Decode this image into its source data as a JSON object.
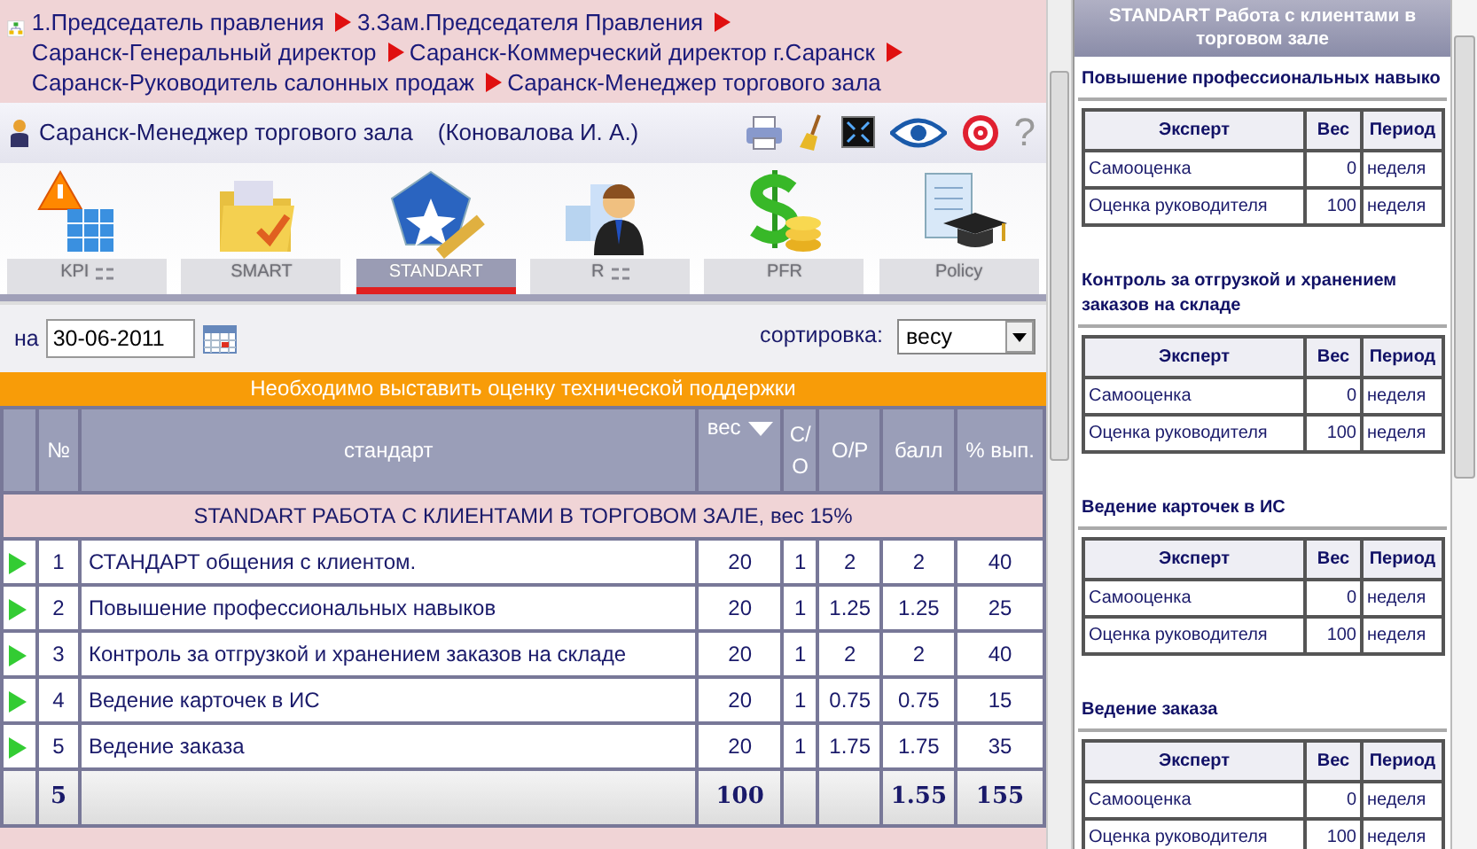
{
  "breadcrumb": [
    "1.Председатель правления",
    "3.Зам.Председателя Правления",
    "Саранск-Генеральный директор",
    "Саранск-Коммерческий директор г.Саранск",
    "Саранск-Руководитель салонных продаж",
    "Саранск-Менеджер торгового зала"
  ],
  "user": {
    "position": "Саранск-Менеджер торгового зала",
    "name": "(Коновалова И. А.)"
  },
  "help_glyph": "?",
  "tabs": [
    {
      "label": "KPI",
      "kind": "kpi",
      "has_menu": true,
      "selected": false
    },
    {
      "label": "SMART",
      "kind": "smart",
      "has_menu": false,
      "selected": false
    },
    {
      "label": "STANDART",
      "kind": "standart",
      "has_menu": false,
      "selected": true
    },
    {
      "label": "R",
      "kind": "rating",
      "has_menu": true,
      "selected": false
    },
    {
      "label": "PFR",
      "kind": "pfr",
      "has_menu": false,
      "selected": false
    },
    {
      "label": "Policy",
      "kind": "policy",
      "has_menu": false,
      "selected": false
    }
  ],
  "filter": {
    "date_label": "на",
    "date": "30-06-2011",
    "sort_label": "сортировка:",
    "sort_value": "весу"
  },
  "notice": "Необходимо выставить оценку технической поддержки",
  "table": {
    "columns": [
      {
        "label": "№",
        "sorted": false
      },
      {
        "label": "стандарт",
        "sorted": false
      },
      {
        "label": "вес",
        "sorted": true
      },
      {
        "label": "С/О",
        "sorted": false
      },
      {
        "label": "О/Р",
        "sorted": false
      },
      {
        "label": "балл",
        "sorted": false
      },
      {
        "label": "% вып.",
        "sorted": false
      }
    ],
    "group": "STANDART РАБОТА С КЛИЕНТАМИ В ТОРГОВОМ ЗАЛЕ, вес 15%",
    "rows": [
      [
        "1",
        "СТАНДАРТ общения с клиентом.",
        "20",
        "1",
        "2",
        "2",
        "40"
      ],
      [
        "2",
        "Повышение профессиональных навыков",
        "20",
        "1",
        "1.25",
        "1.25",
        "25"
      ],
      [
        "3",
        "Контроль за отгрузкой и хранением заказов на складе",
        "20",
        "1",
        "2",
        "2",
        "40"
      ],
      [
        "4",
        "Ведение карточек в ИС",
        "20",
        "1",
        "0.75",
        "0.75",
        "15"
      ],
      [
        "5",
        "Ведение заказа",
        "20",
        "1",
        "1.75",
        "1.75",
        "35"
      ]
    ],
    "totals": {
      "count": "5",
      "weight": "100",
      "score": "1.55",
      "percent": "155"
    }
  },
  "sidebar": {
    "title": "STANDART Работа с клиентами в торговом зале",
    "sections": [
      {
        "title": "Повышение профессиональных навыко",
        "columns": [
          "Эксперт",
          "Вес",
          "Период"
        ],
        "rows": [
          [
            "Самооценка",
            "0",
            "неделя"
          ],
          [
            "Оценка руководителя",
            "100",
            "неделя"
          ]
        ]
      },
      {
        "title": "Контроль за отгрузкой и хранением заказов на складе",
        "columns": [
          "Эксперт",
          "Вес",
          "Период"
        ],
        "rows": [
          [
            "Самооценка",
            "0",
            "неделя"
          ],
          [
            "Оценка руководителя",
            "100",
            "неделя"
          ]
        ]
      },
      {
        "title": "Ведение карточек в ИС",
        "columns": [
          "Эксперт",
          "Вес",
          "Период"
        ],
        "rows": [
          [
            "Самооценка",
            "0",
            "неделя"
          ],
          [
            "Оценка руководителя",
            "100",
            "неделя"
          ]
        ]
      },
      {
        "title": "Ведение заказа",
        "columns": [
          "Эксперт",
          "Вес",
          "Период"
        ],
        "rows": [
          [
            "Самооценка",
            "0",
            "неделя"
          ],
          [
            "Оценка руководителя",
            "100",
            "неделя"
          ]
        ]
      }
    ]
  }
}
